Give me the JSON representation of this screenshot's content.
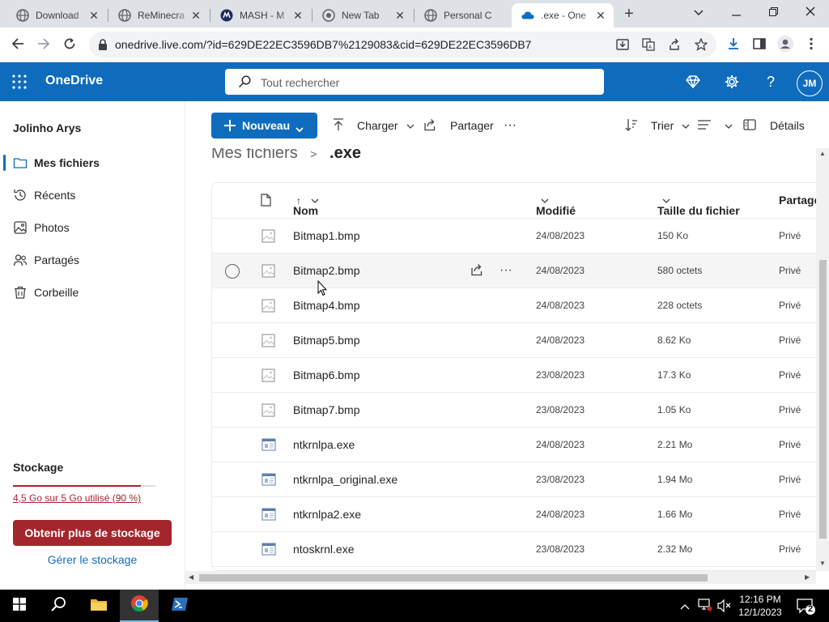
{
  "browser": {
    "tabs": [
      {
        "title": "Download",
        "favicon": "download-globe-icon",
        "active": false
      },
      {
        "title": "ReMinecra",
        "favicon": "globe-icon",
        "active": false
      },
      {
        "title": "MASH - M",
        "favicon": "mash-icon",
        "active": false
      },
      {
        "title": "New Tab",
        "favicon": "chrome-globe-icon",
        "active": false
      },
      {
        "title": "Personal C",
        "favicon": "globe-icon",
        "active": false
      },
      {
        "title": ".exe - One",
        "favicon": "onedrive-icon",
        "active": true
      }
    ],
    "new_tab": "+",
    "url": "onedrive.live.com/?id=629DE22EC3596DB7%2129083&cid=629DE22EC3596DB7"
  },
  "onedrive": {
    "brand": "OneDrive",
    "search_placeholder": "Tout rechercher",
    "avatar_initials": "JM"
  },
  "sidebar": {
    "user": "Jolinho Arys",
    "items": [
      {
        "label": "Mes fichiers",
        "icon": "folder-icon",
        "active": true
      },
      {
        "label": "Récents",
        "icon": "history-icon",
        "active": false
      },
      {
        "label": "Photos",
        "icon": "image-icon",
        "active": false
      },
      {
        "label": "Partagés",
        "icon": "people-icon",
        "active": false
      },
      {
        "label": "Corbeille",
        "icon": "trash-icon",
        "active": false
      }
    ],
    "storage": {
      "title": "Stockage",
      "usage_text": "4,5 Go sur 5 Go utilisé (90 %)",
      "usage_fraction": 0.9,
      "cta": "Obtenir plus de stockage",
      "manage": "Gérer le stockage"
    }
  },
  "commands": {
    "new": "Nouveau",
    "upload": "Charger",
    "share": "Partager",
    "more": "···",
    "sort": "Trier",
    "details": "Détails"
  },
  "breadcrumb": {
    "parent": "Mes fichiers",
    "separator": ">",
    "current": ".exe"
  },
  "table": {
    "headers": {
      "name": "Nom",
      "sort_indicator": "↑",
      "modified": "Modifié",
      "size": "Taille du fichier",
      "sharing": "Partage"
    },
    "rows": [
      {
        "name": "Bitmap1.bmp",
        "type": "image",
        "modified": "24/08/2023",
        "size": "150 Ko",
        "sharing": "Privé"
      },
      {
        "name": "Bitmap2.bmp",
        "type": "image",
        "modified": "24/08/2023",
        "size": "580 octets",
        "sharing": "Privé",
        "hover": true
      },
      {
        "name": "Bitmap4.bmp",
        "type": "image",
        "modified": "24/08/2023",
        "size": "228 octets",
        "sharing": "Privé"
      },
      {
        "name": "Bitmap5.bmp",
        "type": "image",
        "modified": "24/08/2023",
        "size": "8.62 Ko",
        "sharing": "Privé"
      },
      {
        "name": "Bitmap6.bmp",
        "type": "image",
        "modified": "23/08/2023",
        "size": "17.3 Ko",
        "sharing": "Privé"
      },
      {
        "name": "Bitmap7.bmp",
        "type": "image",
        "modified": "23/08/2023",
        "size": "1.05 Ko",
        "sharing": "Privé"
      },
      {
        "name": "ntkrnlpa.exe",
        "type": "exe",
        "modified": "24/08/2023",
        "size": "2.21 Mo",
        "sharing": "Privé"
      },
      {
        "name": "ntkrnlpa_original.exe",
        "type": "exe",
        "modified": "23/08/2023",
        "size": "1.94 Mo",
        "sharing": "Privé"
      },
      {
        "name": "ntkrnlpa2.exe",
        "type": "exe",
        "modified": "24/08/2023",
        "size": "1.66 Mo",
        "sharing": "Privé"
      },
      {
        "name": "ntoskrnl.exe",
        "type": "exe",
        "modified": "23/08/2023",
        "size": "2.32 Mo",
        "sharing": "Privé"
      }
    ]
  },
  "taskbar": {
    "time": "12:16 PM",
    "date": "12/1/2023",
    "notification_count": "2"
  },
  "colors": {
    "accent": "#0f6cbd",
    "danger": "#a4262c",
    "taskbar": "#000000"
  }
}
